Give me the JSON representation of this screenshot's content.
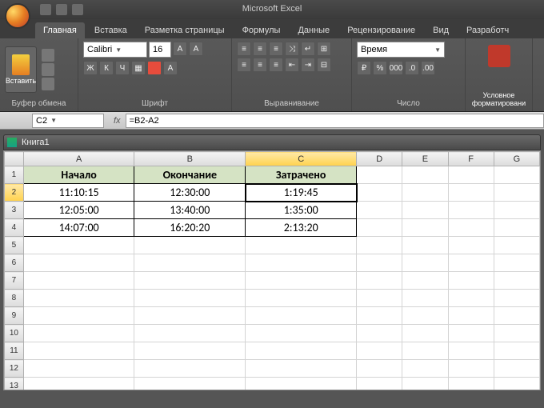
{
  "app": {
    "title": "Microsoft Excel"
  },
  "tabs": {
    "items": [
      "Главная",
      "Вставка",
      "Разметка страницы",
      "Формулы",
      "Данные",
      "Рецензирование",
      "Вид",
      "Разработч"
    ],
    "active": 0
  },
  "ribbon": {
    "clipboard": {
      "paste": "Вставить",
      "label": "Буфер обмена"
    },
    "font": {
      "name": "Calibri",
      "size": "16",
      "bold": "Ж",
      "italic": "К",
      "underline": "Ч",
      "label": "Шрифт"
    },
    "alignment": {
      "label": "Выравнивание"
    },
    "number": {
      "format": "Время",
      "label": "Число"
    },
    "conditional": {
      "label": "Условное форматировани"
    }
  },
  "formula_bar": {
    "cell_ref": "C2",
    "fx": "fx",
    "formula": "=B2-A2"
  },
  "workbook": {
    "title": "Книга1"
  },
  "sheet": {
    "columns": [
      "A",
      "B",
      "C",
      "D",
      "E",
      "F",
      "G"
    ],
    "headers": [
      "Начало",
      "Окончание",
      "Затрачено"
    ],
    "rows": [
      {
        "start": "11:10:15",
        "end": "12:30:00",
        "elapsed": "1:19:45"
      },
      {
        "start": "12:05:00",
        "end": "13:40:00",
        "elapsed": "1:35:00"
      },
      {
        "start": "14:07:00",
        "end": "16:20:20",
        "elapsed": "2:13:20"
      }
    ],
    "selected": "C2"
  }
}
